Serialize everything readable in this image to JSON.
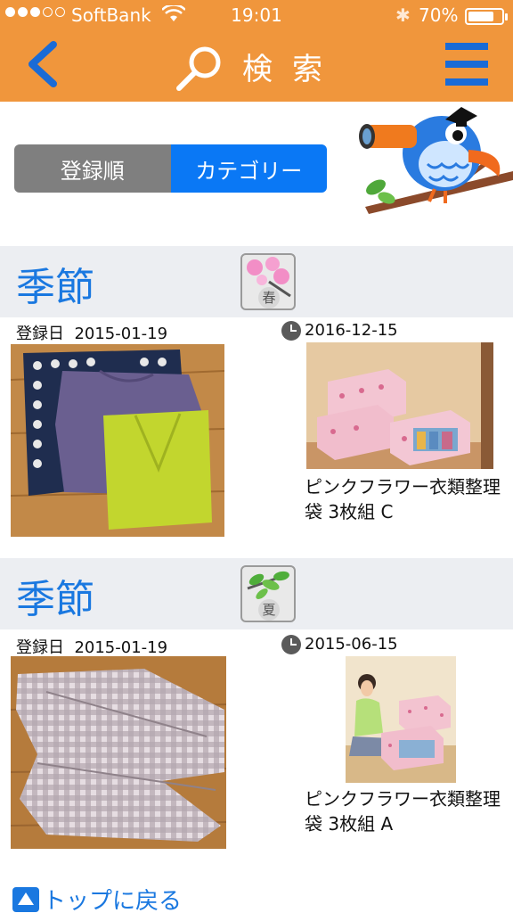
{
  "status_bar": {
    "carrier": "SoftBank",
    "time": "19:01",
    "battery": "70%",
    "battery_level": 0.7
  },
  "header": {
    "title": "検索",
    "back_icon": "chevron-left-icon",
    "search_icon": "search-icon",
    "menu_icon": "hamburger-menu-icon"
  },
  "segment": {
    "options": [
      "登録順",
      "カテゴリー"
    ],
    "selected": "カテゴリー"
  },
  "sections": [
    {
      "title": "季節",
      "category_icon_label": "春",
      "registered_label": "登録日",
      "registered_date": "2015-01-19",
      "reminder_date": "2016-12-15",
      "product_name": "ピンクフラワー衣類整理袋 3枚組 C"
    },
    {
      "title": "季節",
      "category_icon_label": "夏",
      "registered_label": "登録日",
      "registered_date": "2015-01-19",
      "reminder_date": "2015-06-15",
      "product_name": "ピンクフラワー衣類整理袋 3枚組 A"
    }
  ],
  "footer": {
    "back_to_top": "トップに戻る"
  },
  "colors": {
    "header_bg": "#f0963c",
    "accent_blue": "#0a78f5",
    "title_blue": "#1a78e0",
    "section_bg": "#eceef2"
  }
}
